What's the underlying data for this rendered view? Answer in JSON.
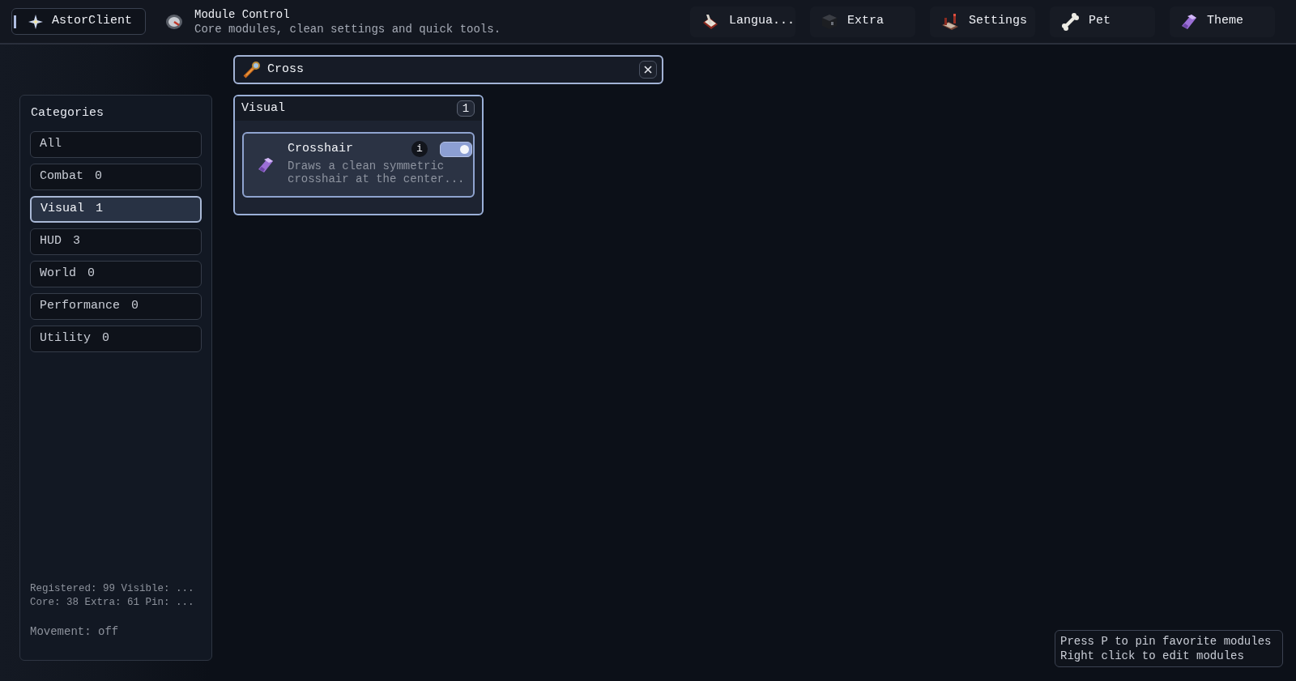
{
  "brand": {
    "label": "AstorClient"
  },
  "header": {
    "title": "Module Control",
    "subtitle": "Core modules, clean settings and quick tools."
  },
  "tabs": [
    {
      "label": "Langua..."
    },
    {
      "label": "Extra"
    },
    {
      "label": "Settings"
    },
    {
      "label": "Pet"
    },
    {
      "label": "Theme"
    }
  ],
  "search": {
    "value": "Cross"
  },
  "sidebar": {
    "title": "Categories",
    "items": [
      {
        "label": "All",
        "selected": false
      },
      {
        "label": "Combat",
        "count": "0",
        "selected": false
      },
      {
        "label": "Visual",
        "count": "1",
        "selected": true
      },
      {
        "label": "HUD",
        "count": "3",
        "selected": false
      },
      {
        "label": "World",
        "count": "0",
        "selected": false
      },
      {
        "label": "Performance",
        "count": "0",
        "selected": false
      },
      {
        "label": "Utility",
        "count": "0",
        "selected": false
      }
    ],
    "stats": [
      "Registered: 99 Visible: ...",
      "Core: 38 Extra: 61 Pin: ..."
    ],
    "movement": "Movement: off"
  },
  "groups": [
    {
      "title": "Visual",
      "count": "1",
      "modules": [
        {
          "name": "Crosshair",
          "description": "Draws a clean symmetric crosshair at the center...",
          "info_label": "i",
          "on": true
        }
      ]
    }
  ],
  "hint": [
    "Press P to pin favorite modules",
    "Right click to edit modules"
  ]
}
